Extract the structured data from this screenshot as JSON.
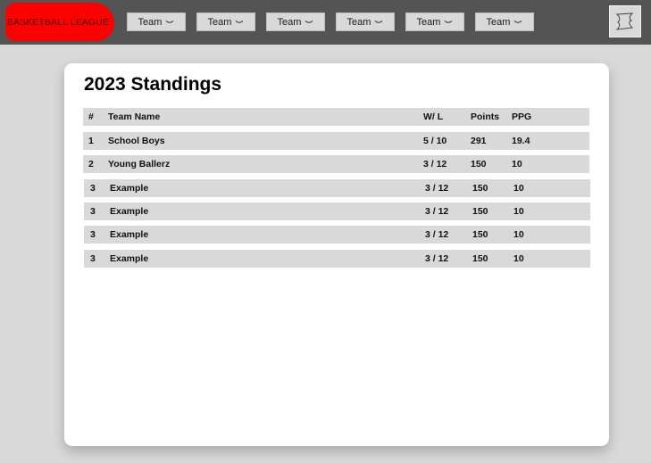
{
  "header": {
    "logo_text": "BASKETBALL LEAGUE",
    "nav_items": [
      {
        "label": "Team"
      },
      {
        "label": "Team"
      },
      {
        "label": "Team"
      },
      {
        "label": "Team"
      },
      {
        "label": "Team"
      },
      {
        "label": "Team"
      }
    ],
    "profile_icon": "profile-icon",
    "logo_color": "#ff0000",
    "bar_color": "#545454"
  },
  "standings": {
    "title": "2023 Standings",
    "columns": {
      "rank": "#",
      "team": "Team Name",
      "wl": "W/ L",
      "points": "Points",
      "ppg": "PPG"
    },
    "rows": [
      {
        "rank": "1",
        "team": "School Boys",
        "wl": "5 / 10",
        "points": "291",
        "ppg": "19.4"
      },
      {
        "rank": "2",
        "team": "Young Ballerz",
        "wl": "3 / 12",
        "points": "150",
        "ppg": "10"
      },
      {
        "rank": "3",
        "team": "Example",
        "wl": "3 / 12",
        "points": "150",
        "ppg": "10"
      },
      {
        "rank": "3",
        "team": "Example",
        "wl": "3 / 12",
        "points": "150",
        "ppg": "10"
      },
      {
        "rank": "3",
        "team": "Example",
        "wl": "3 / 12",
        "points": "150",
        "ppg": "10"
      },
      {
        "rank": "3",
        "team": "Example",
        "wl": "3 / 12",
        "points": "150",
        "ppg": "10"
      }
    ]
  }
}
